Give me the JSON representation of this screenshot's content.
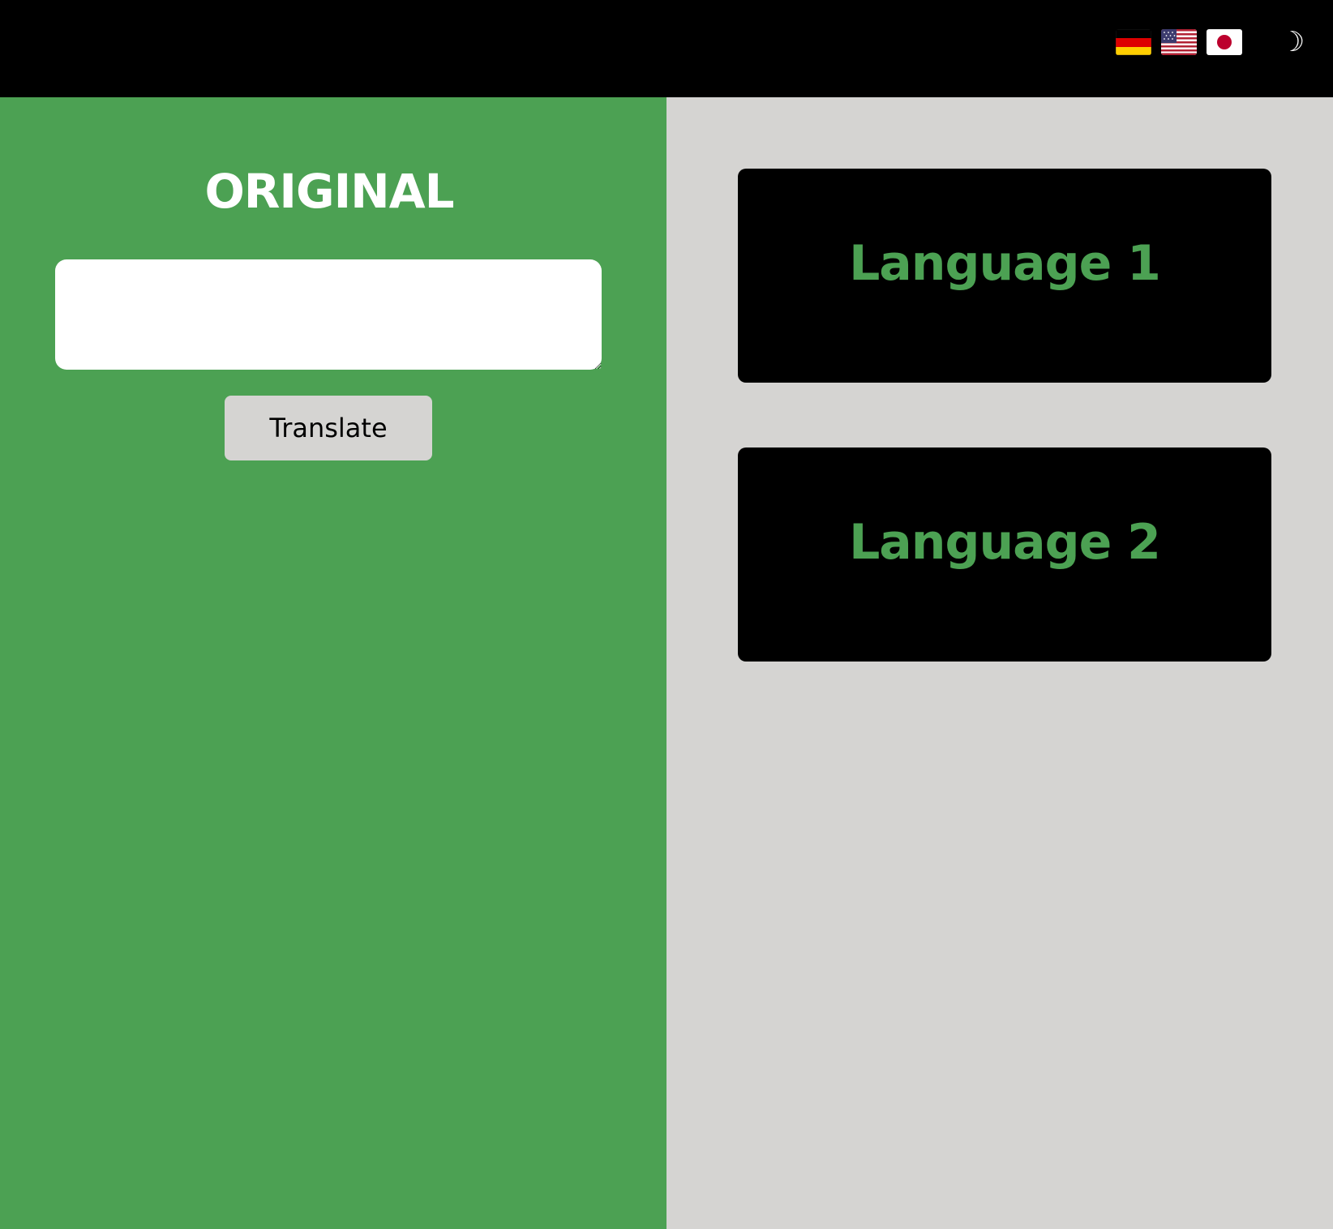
{
  "header": {
    "flags": [
      {
        "name": "germany-flag"
      },
      {
        "name": "usa-flag"
      },
      {
        "name": "japan-flag"
      }
    ],
    "theme_toggle_glyph": "☽"
  },
  "original": {
    "title": "ORIGINAL",
    "input_value": "",
    "translate_label": "Translate"
  },
  "outputs": [
    {
      "title": "Language 1"
    },
    {
      "title": "Language 2"
    }
  ],
  "colors": {
    "accent_green": "#4ca153",
    "panel_gray": "#d5d4d2",
    "header_black": "#000000"
  }
}
